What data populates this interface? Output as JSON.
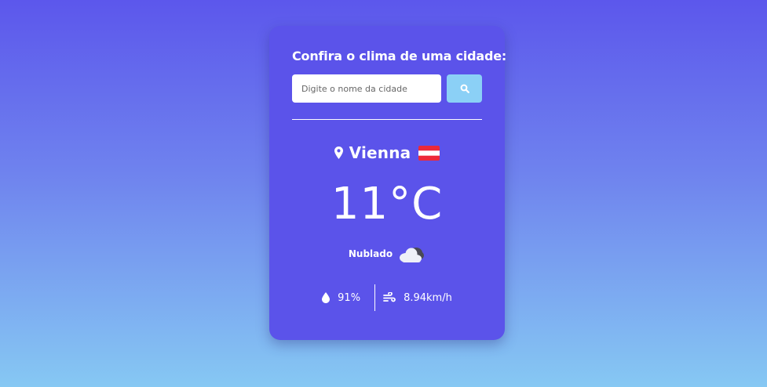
{
  "weather_card": {
    "title": "Confira o clima de uma cidade:",
    "search": {
      "placeholder": "Digite o nome da cidade",
      "value": ""
    },
    "location": {
      "city": "Vienna",
      "pin_icon": "map-marker-icon",
      "flag_icon": "austria-flag-icon"
    },
    "temperature": {
      "value": "11",
      "unit": "°C"
    },
    "condition": {
      "description": "Nublado",
      "icon": "cloudy-icon"
    },
    "stats": {
      "humidity": "91%",
      "humidity_icon": "droplet-icon",
      "wind": "8.94km/h",
      "wind_icon": "wind-icon"
    }
  },
  "colors": {
    "card_background": "#5b53ea",
    "search_button": "#8bd0f6",
    "gradient_top": "#5c57ec",
    "gradient_bottom": "#86c8f3",
    "flag_red": "#ed2939",
    "flag_white": "#ffffff"
  }
}
